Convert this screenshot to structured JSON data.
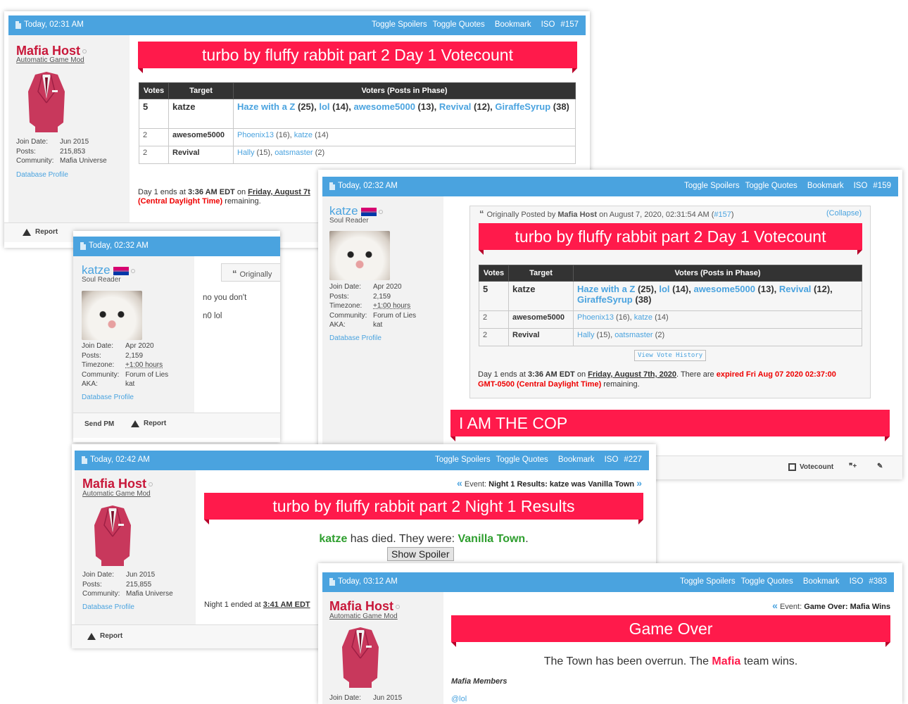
{
  "post157": {
    "date": "Today, 02:31 AM",
    "links": [
      "Toggle Spoilers",
      "Toggle Quotes",
      "Bookmark",
      "ISO",
      "#157"
    ],
    "user": {
      "name": "Mafia Host",
      "title": "Automatic Game Mod",
      "join_label": "Join Date:",
      "join": "Jun 2015",
      "posts_label": "Posts:",
      "posts": "215,853",
      "community_label": "Community:",
      "community": "Mafia Universe",
      "db": "Database Profile"
    },
    "banner": "turbo by fluffy rabbit part 2 Day 1 Votecount",
    "table": {
      "headers": [
        "Votes",
        "Target",
        "Voters (Posts in Phase)"
      ],
      "rows": [
        {
          "votes": "5",
          "target": "katze",
          "voters": [
            [
              "Haze with a Z",
              " (25), "
            ],
            [
              "lol",
              " (14), "
            ],
            [
              "awesome5000",
              " (13), "
            ],
            [
              "Revival",
              " (12), "
            ],
            [
              "GiraffeSyrup",
              " (38)"
            ]
          ]
        },
        {
          "votes": "2",
          "target": "awesome5000",
          "voters": [
            [
              "Phoenix13",
              " (16), "
            ],
            [
              "katze",
              " (14)"
            ]
          ]
        },
        {
          "votes": "2",
          "target": "Revival",
          "voters": [
            [
              "Hally",
              " (15), "
            ],
            [
              "oatsmaster",
              " (2)"
            ]
          ]
        }
      ]
    },
    "ends_prefix": "Day 1 ends at ",
    "ends_time": "3:36 AM EDT",
    "ends_on": " on ",
    "ends_date": "Friday, August 7t",
    "ends_tz": "(Central Daylight Time)",
    "ends_remaining": " remaining.",
    "report": "Report"
  },
  "post_katze_left": {
    "date": "Today, 02:32 AM",
    "user": {
      "name": "katze",
      "title": "Soul Reader",
      "join_label": "Join Date:",
      "join": "Apr 2020",
      "posts_label": "Posts:",
      "posts": "2,159",
      "tz_label": "Timezone:",
      "tz": "+1:00 hours",
      "community_label": "Community:",
      "community": "Forum of Lies",
      "aka_label": "AKA:",
      "aka": "kat",
      "db": "Database Profile"
    },
    "quote_label": "Originally",
    "line1": "no you don't",
    "line2": "n0 lol",
    "send_pm": "Send PM",
    "report": "Report"
  },
  "post159": {
    "date": "Today, 02:32 AM",
    "links": [
      "Toggle Spoilers",
      "Toggle Quotes",
      "Bookmark",
      "ISO",
      "#159"
    ],
    "user": {
      "name": "katze",
      "title": "Soul Reader",
      "join_label": "Join Date:",
      "join": "Apr 2020",
      "posts_label": "Posts:",
      "posts": "2,159",
      "tz_label": "Timezone:",
      "tz": "+1:00 hours",
      "community_label": "Community:",
      "community": "Forum of Lies",
      "aka_label": "AKA:",
      "aka": "kat",
      "db": "Database Profile"
    },
    "quote_prefix": "Originally Posted by ",
    "quote_author": "Mafia Host",
    "quote_mid": " on August 7, 2020, 02:31:54 AM (",
    "quote_ref": "#157",
    "quote_end": ")",
    "collapse": "(Collapse)",
    "banner": "turbo by fluffy rabbit part 2 Day 1 Votecount",
    "vote_history": "View Vote History",
    "ends_prefix": "Day 1 ends at ",
    "ends_time": "3:36 AM EDT",
    "ends_on": " on ",
    "ends_date": "Friday, August 7th, 2020",
    "ends_there": ". There are ",
    "ends_expired": "expired Fri Aug 07 2020 02:37:00",
    "ends_gmt": "GMT-0500 (Central Daylight Time)",
    "ends_remaining": " remaining.",
    "cop_banner": "I AM THE COP",
    "votecount_btn": "Votecount"
  },
  "post227": {
    "date": "Today, 02:42 AM",
    "links": [
      "Toggle Spoilers",
      "Toggle Quotes",
      "Bookmark",
      "ISO",
      "#227"
    ],
    "user": {
      "name": "Mafia Host",
      "title": "Automatic Game Mod",
      "join_label": "Join Date:",
      "join": "Jun 2015",
      "posts_label": "Posts:",
      "posts": "215,855",
      "community_label": "Community:",
      "community": "Mafia Universe",
      "db": "Database Profile"
    },
    "event_label": "Event: ",
    "event": "Night 1 Results: katze was Vanilla Town",
    "banner": "turbo by fluffy rabbit part 2 Night 1 Results",
    "died_name": "katze",
    "died_mid": " has died. They were: ",
    "died_role": "Vanilla Town",
    "died_end": ".",
    "spoiler_btn": "Show Spoiler",
    "night_prefix": "Night 1 ended at ",
    "night_time": "3:41 AM EDT",
    "report": "Report"
  },
  "post383": {
    "date": "Today, 03:12 AM",
    "links": [
      "Toggle Spoilers",
      "Toggle Quotes",
      "Bookmark",
      "ISO",
      "#383"
    ],
    "user": {
      "name": "Mafia Host",
      "title": "Automatic Game Mod",
      "join_label": "Join Date:",
      "join": "Jun 2015"
    },
    "event_label": "Event: ",
    "event": "Game Over: Mafia Wins",
    "banner": "Game Over",
    "text_a": "The Town has been overrun. The ",
    "text_mafia": "Mafia",
    "text_b": " team wins.",
    "members_label": "Mafia Members",
    "member1": "@lol"
  },
  "colors": {
    "header_blue": "#4aa3df",
    "banner_red": "#ff1a4b",
    "host_red": "#c8183a",
    "win_green": "#2e9e2e"
  }
}
